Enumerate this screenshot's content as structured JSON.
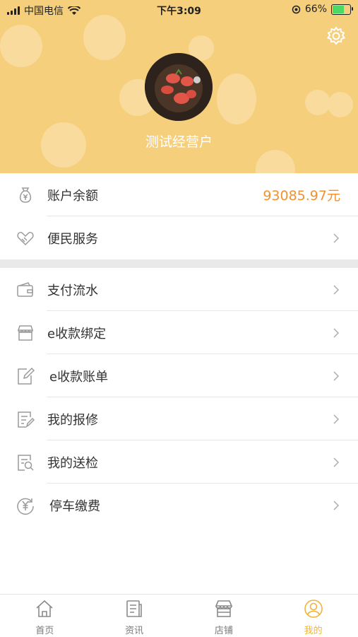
{
  "status": {
    "carrier": "中国电信",
    "time": "下午3:09",
    "battery": "66%",
    "battery_level": 0.66
  },
  "profile": {
    "name": "测试经营户"
  },
  "account": {
    "balance_label": "账户余额",
    "balance_value": "93085.97元",
    "service_label": "便民服务"
  },
  "menu": [
    {
      "label": "支付流水",
      "icon": "wallet-icon"
    },
    {
      "label": "e收款绑定",
      "icon": "store-icon"
    },
    {
      "label": "e收款账单",
      "icon": "edit-bill-icon"
    },
    {
      "label": "我的报修",
      "icon": "repair-doc-icon"
    },
    {
      "label": "我的送检",
      "icon": "inspect-search-icon"
    },
    {
      "label": "停车缴费",
      "icon": "yen-refresh-icon"
    }
  ],
  "tabs": [
    {
      "label": "首页",
      "icon": "home-icon"
    },
    {
      "label": "资讯",
      "icon": "news-icon"
    },
    {
      "label": "店铺",
      "icon": "shop-icon"
    },
    {
      "label": "我的",
      "icon": "user-icon"
    }
  ],
  "colors": {
    "header": "#f6cf7c",
    "accent": "#f0922e",
    "tab_active": "#f0b43c"
  }
}
